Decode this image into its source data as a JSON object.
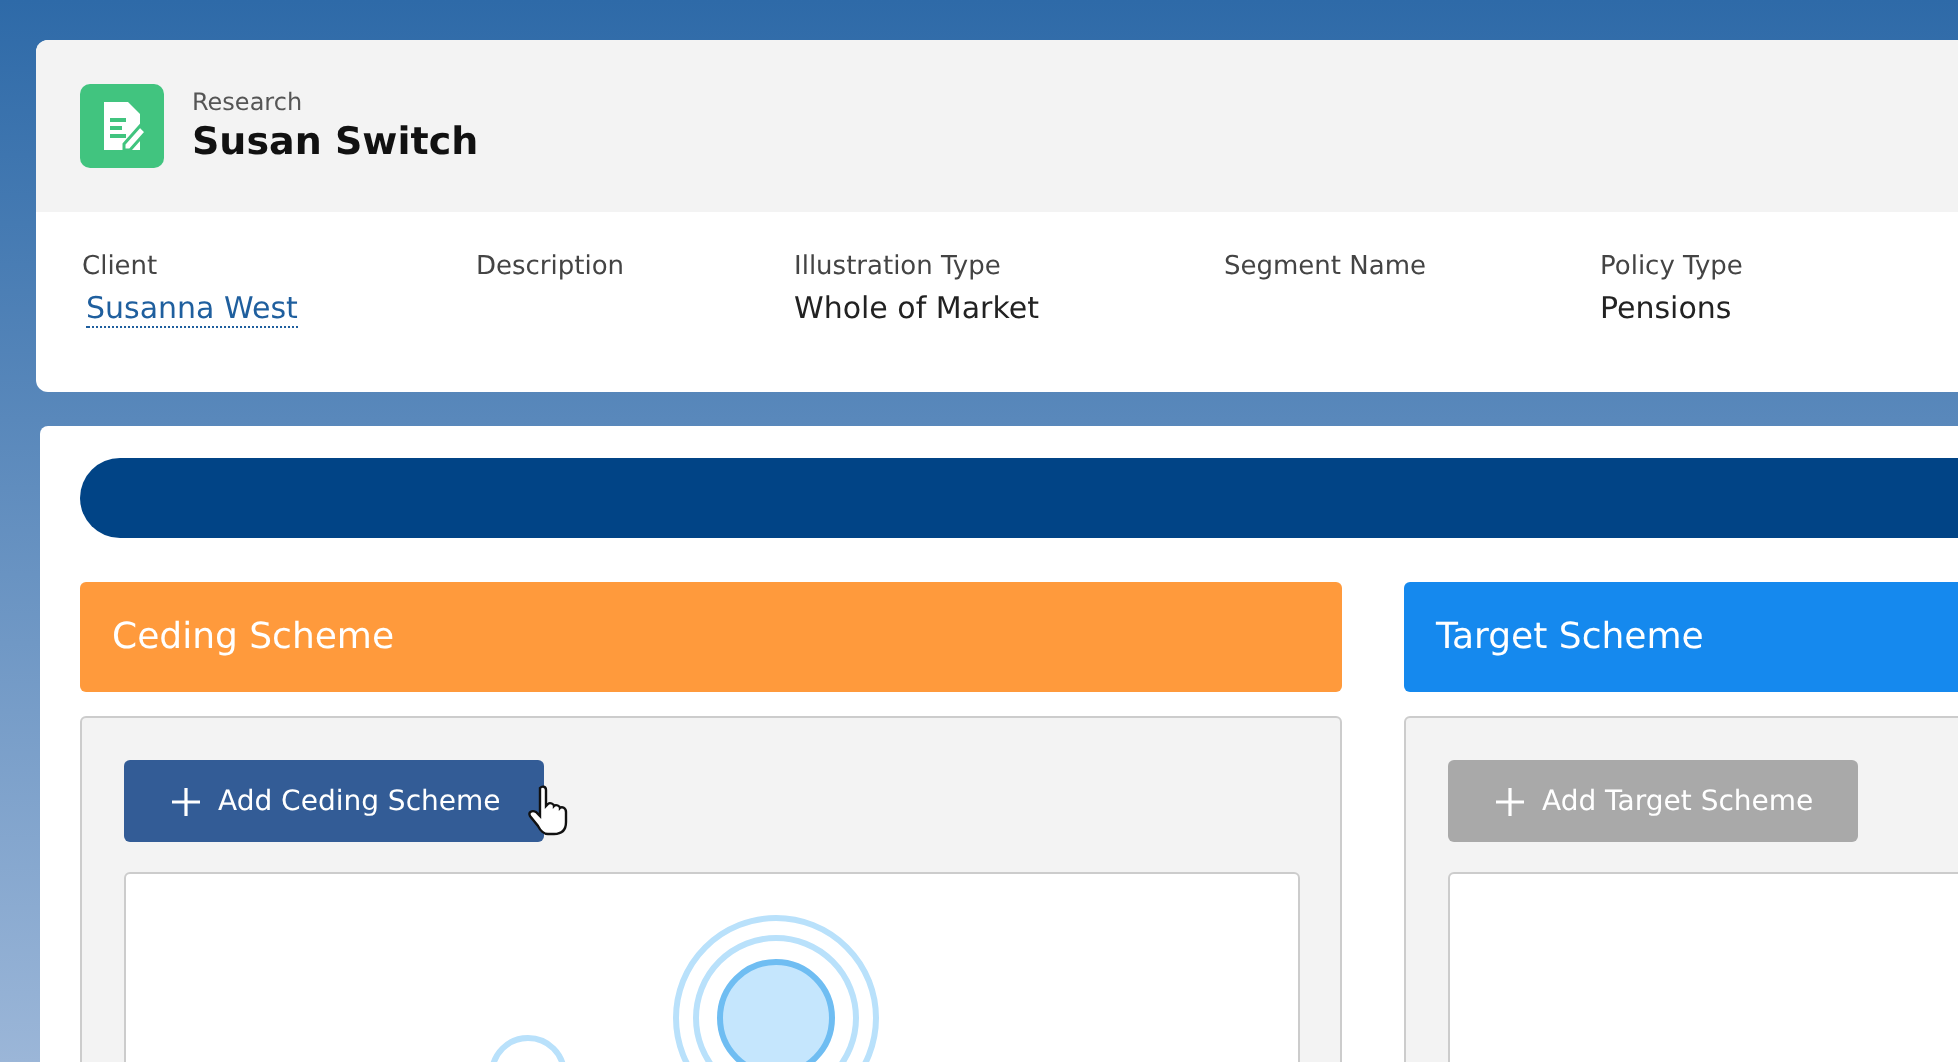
{
  "header": {
    "object_type": "Research",
    "title": "Susan Switch"
  },
  "fields": [
    {
      "label": "Client",
      "value": "Susanna West",
      "kind": "link"
    },
    {
      "label": "Description"
    },
    {
      "label": "Illustration Type",
      "value": "Whole of Market",
      "kind": "text"
    },
    {
      "label": "Segment Name"
    },
    {
      "label": "Policy Type",
      "value": "Pensions",
      "kind": "text"
    }
  ],
  "schemes": [
    {
      "title": "Ceding Scheme",
      "color": "#ff9a3c",
      "button": "Add Ceding Scheme",
      "disabled": false
    },
    {
      "title": "Target Scheme",
      "color": "#1589ee",
      "button": "Add Target Scheme",
      "disabled": true
    }
  ]
}
